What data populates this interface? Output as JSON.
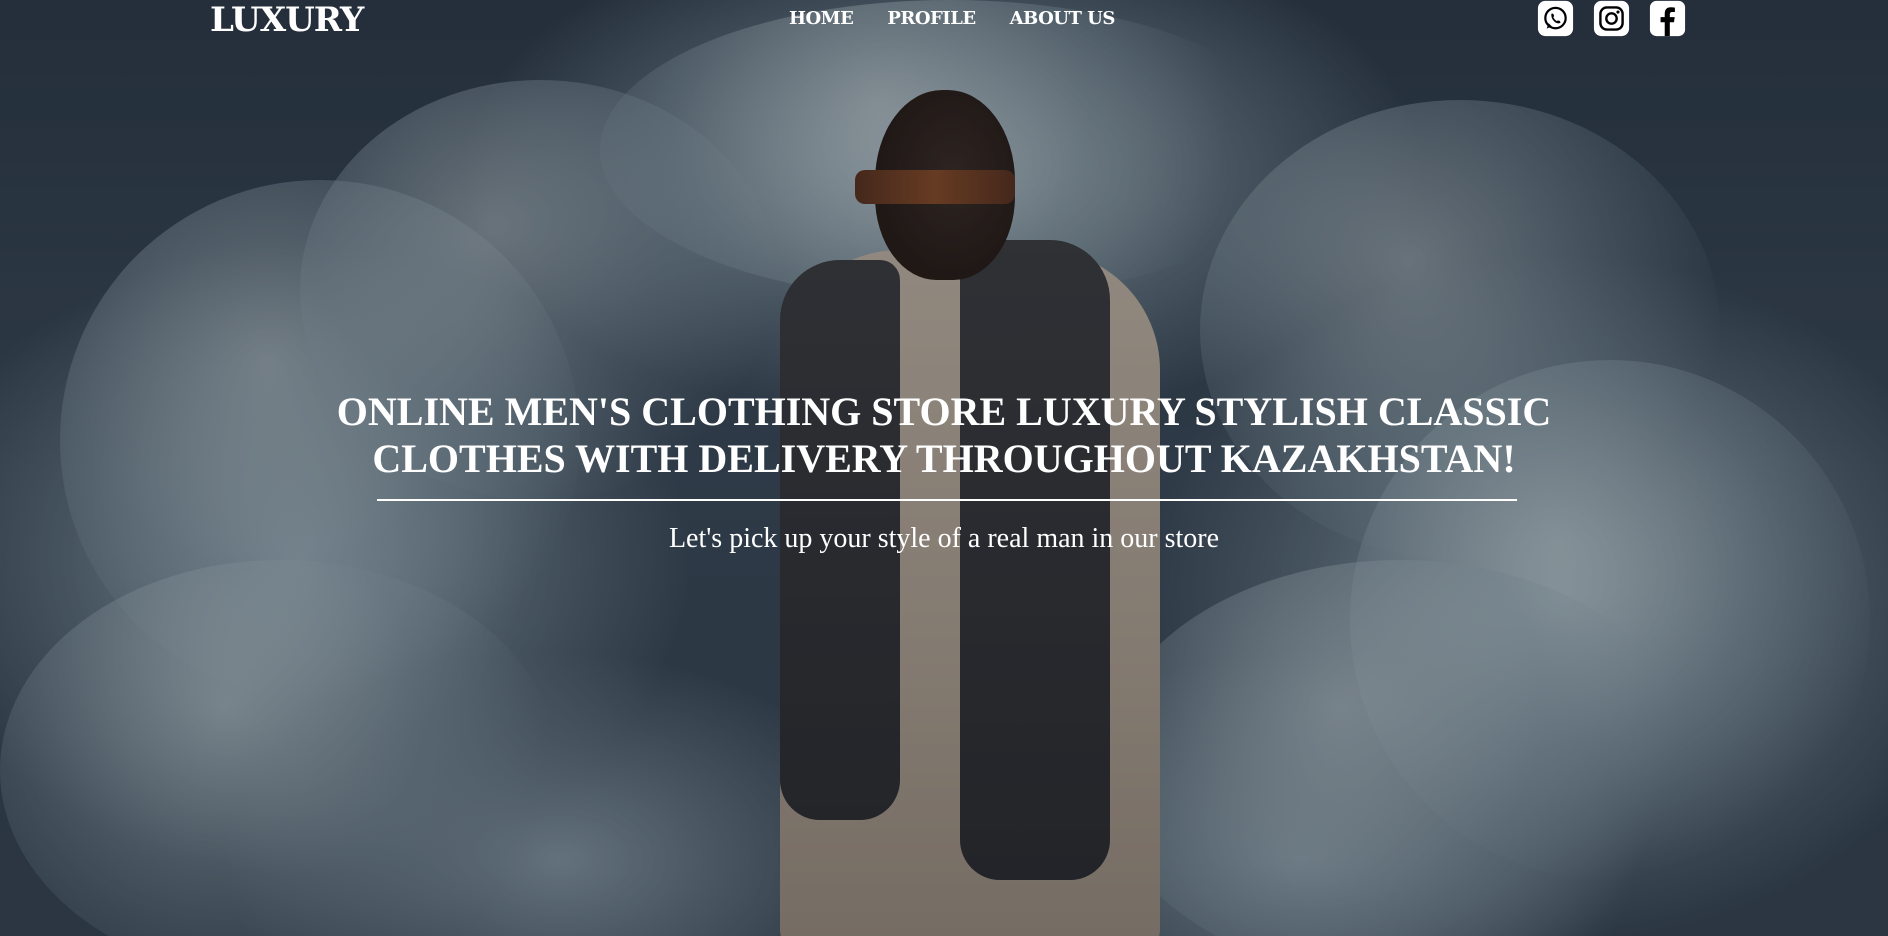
{
  "brand": {
    "logo_text": "LUXURY"
  },
  "nav": {
    "items": [
      {
        "label": "HOME"
      },
      {
        "label": "PROFILE"
      },
      {
        "label": "ABOUT US"
      }
    ]
  },
  "socials": [
    {
      "icon": "whatsapp-icon"
    },
    {
      "icon": "instagram-icon"
    },
    {
      "icon": "facebook-icon"
    }
  ],
  "hero": {
    "headline": "ONLINE MEN'S CLOTHING STORE LUXURY STYLISH CLASSIC CLOTHES WITH DELIVERY THROUGHOUT KAZAKHSTAN!",
    "subtitle": "Let's pick up your style of a real man in our store"
  },
  "colors": {
    "text": "#ffffff",
    "background_dark": "#2c3845"
  }
}
